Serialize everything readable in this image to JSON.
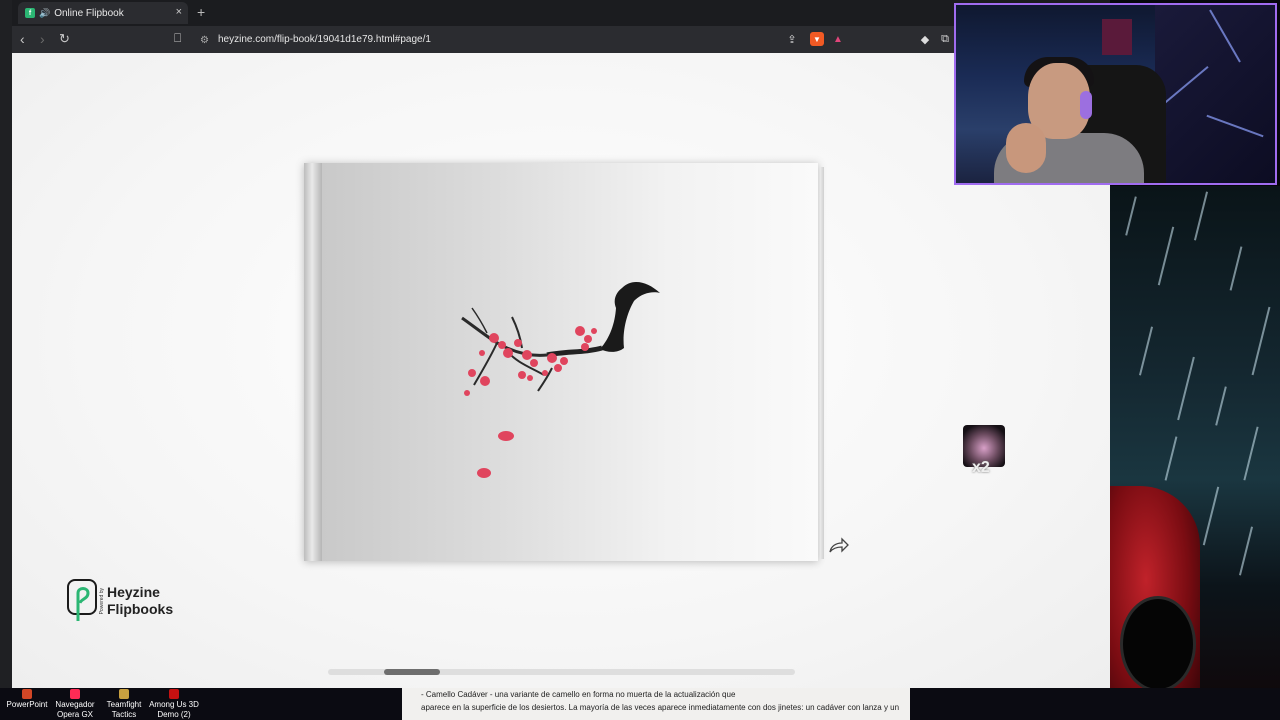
{
  "browser": {
    "tab_title": "Online Flipbook",
    "new_tab": "+",
    "close": "×",
    "url": "heyzine.com/flip-book/19041d1e79.html#page/1"
  },
  "viewer": {
    "logo_powered": "Powered by",
    "logo_line1": "Heyzine",
    "logo_line2": "Flipbooks",
    "avatar_badge": "x2",
    "scroll_position": 0.12
  },
  "taskbar": {
    "items": [
      {
        "label": "PowerPoint"
      },
      {
        "label": "Navegador Opera GX"
      },
      {
        "label": "Teamfight Tactics"
      },
      {
        "label": "Among Us 3D Demo (2)"
      }
    ]
  },
  "overlay": {
    "line1": "- Camello Cadáver - una variante de camello en forma no muerta de la actualización que",
    "line2": "aparece en la superficie de los desiertos. La mayoría de las veces aparece inmediatamente con dos jinetes: un cadáver con lanza y un"
  },
  "colors": {
    "accent": "#2bb673",
    "webcam_border": "#a06cf0",
    "blossom": "#e0455e"
  }
}
